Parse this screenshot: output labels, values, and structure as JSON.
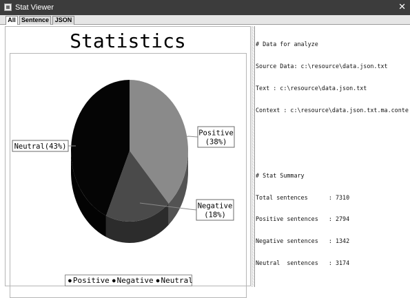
{
  "window": {
    "title": "Stat Viewer"
  },
  "tabs": [
    {
      "label": "All"
    },
    {
      "label": "Sentence"
    },
    {
      "label": "JSON"
    }
  ],
  "chart": {
    "title": "Statistics",
    "labels": {
      "positive_line1": "Positive",
      "positive_line2": "(38%)",
      "negative_line1": "Negative",
      "negative_line2": "(18%)",
      "neutral": "Neutral(43%)"
    },
    "legend": [
      {
        "label": "Positive",
        "color": "#8a8a8a"
      },
      {
        "label": "Negative",
        "color": "#4a4a4a"
      },
      {
        "label": "Neutral",
        "color": "#050505"
      }
    ]
  },
  "chart_data": {
    "type": "pie",
    "title": "Statistics",
    "categories": [
      "Positive",
      "Negative",
      "Neutral"
    ],
    "values": [
      38,
      18,
      43
    ],
    "colors": [
      "#8a8a8a",
      "#4a4a4a",
      "#050505"
    ],
    "legend": "bottom"
  },
  "text_panel": {
    "lines": [
      "# Data for analyze",
      "Source Data: c:\\resource\\data.json.txt",
      "Text : c:\\resource\\data.json.txt",
      "Context : c:\\resource\\data.json.txt.ma.context",
      "",
      "",
      "# Stat Summary",
      "Total sentences      : 7310",
      "Positive sentences   : 2794",
      "Negative sentences   : 1342",
      "Neutral  sentences   : 3174"
    ]
  }
}
